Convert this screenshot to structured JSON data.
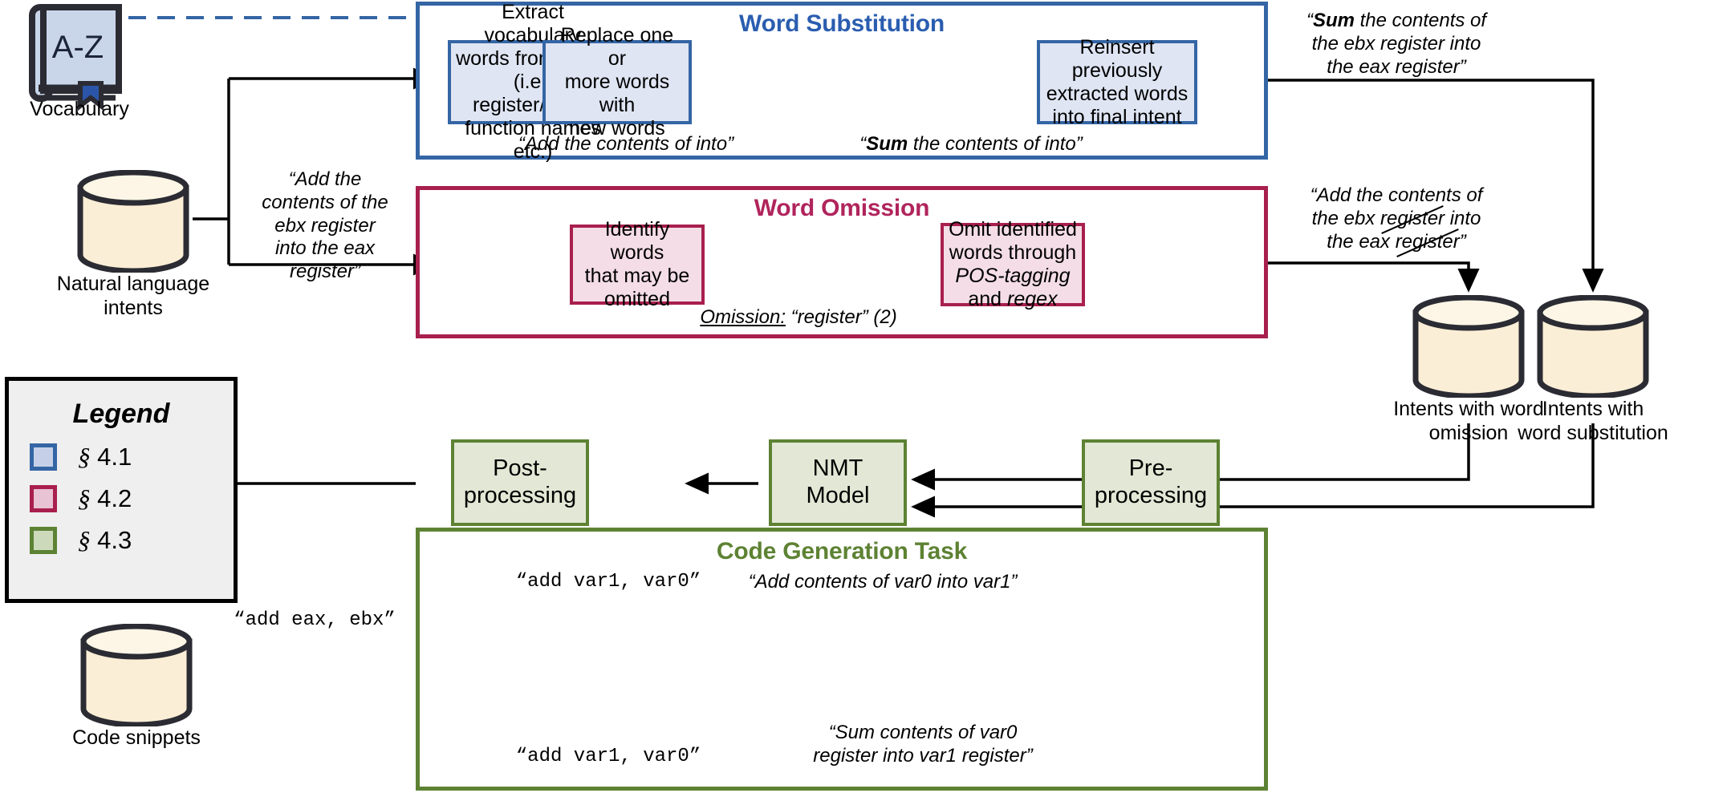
{
  "diagram": {
    "title_sub": "Word Substitution",
    "title_omi": "Word Omission",
    "title_code": "Code Generation Task"
  },
  "vocabulary": {
    "cover_text": "A-Z",
    "label": "Vocabulary"
  },
  "sources": {
    "nl_intents_label_line1": "Natural language",
    "nl_intents_label_line2": "intents",
    "code_snippets_label": "Code snippets",
    "intents_omission_line1": "Intents with word",
    "intents_omission_line2": "omission",
    "intents_substitution_line1": "Intents with",
    "intents_substitution_line2": "word substitution"
  },
  "input_quote": {
    "l1": "“Add the",
    "l2": "contents of the",
    "l3": "ebx register",
    "l4": "into the eax",
    "l5": "register”"
  },
  "substitution": {
    "boxes": [
      "Extract vocabulary words from intent (i.e., register/label/ function names etc.)",
      "Replace one or more words with new words",
      "Reinsert previously extracted words into final intent"
    ],
    "box1_lines": [
      "Extract vocabulary",
      "words from intent",
      "(i.e., register/label/",
      "function names etc.)"
    ],
    "box2_lines": [
      "Replace one or",
      "more words with",
      "new words"
    ],
    "box3_lines": [
      "Reinsert previously",
      "extracted words",
      "into final intent"
    ],
    "caption_left": "“Add the contents of into”",
    "caption_right_bold": "Sum",
    "caption_right_rest": " the contents of into”",
    "caption_right_open": "“",
    "output_bold": "Sum",
    "output_l1_rest": " the contents of",
    "output_l1_open": "“",
    "output_l2": "the ebx register into",
    "output_l3": "the eax register”"
  },
  "omission": {
    "box1_lines": [
      "Identify words",
      "that may be",
      "omitted"
    ],
    "box2_line1": "Omit identified",
    "box2_line2": "words through",
    "box2_line3_italic": "POS-tagging",
    "box2_line4_plain": "and ",
    "box2_line4_italic": "regex",
    "caption_label": "Omission:",
    "caption_rest": " “register” (2)",
    "output_l1": "“Add the contents of",
    "output_l2_pre": "the ebx ",
    "output_l2_strike": "register",
    "output_l2_post": " into",
    "output_l3_pre": "the eax ",
    "output_l3_strike": "register",
    "output_l3_post": "”"
  },
  "codegen": {
    "box_post_l1": "Post-",
    "box_post_l2": "processing",
    "box_nmt_l1": "NMT",
    "box_nmt_l2": "Model",
    "box_pre_l1": "Pre-",
    "box_pre_l2": "processing",
    "cap_top_left": "“add var1, var0”",
    "cap_bottom_left": "“add var1, var0”",
    "cap_top_right": "“Add contents of var0 into var1”",
    "cap_bottom_right_l1": "“Sum contents of var0",
    "cap_bottom_right_l2": "register into var1 register”",
    "cap_output": "“add eax, ebx”"
  },
  "legend": {
    "title": "Legend",
    "section_glyph": "§",
    "items": [
      {
        "ref": "4.1",
        "color": "#3465a4"
      },
      {
        "ref": "4.2",
        "color": "#a81f4d"
      },
      {
        "ref": "4.3",
        "color": "#5d8233"
      }
    ]
  }
}
